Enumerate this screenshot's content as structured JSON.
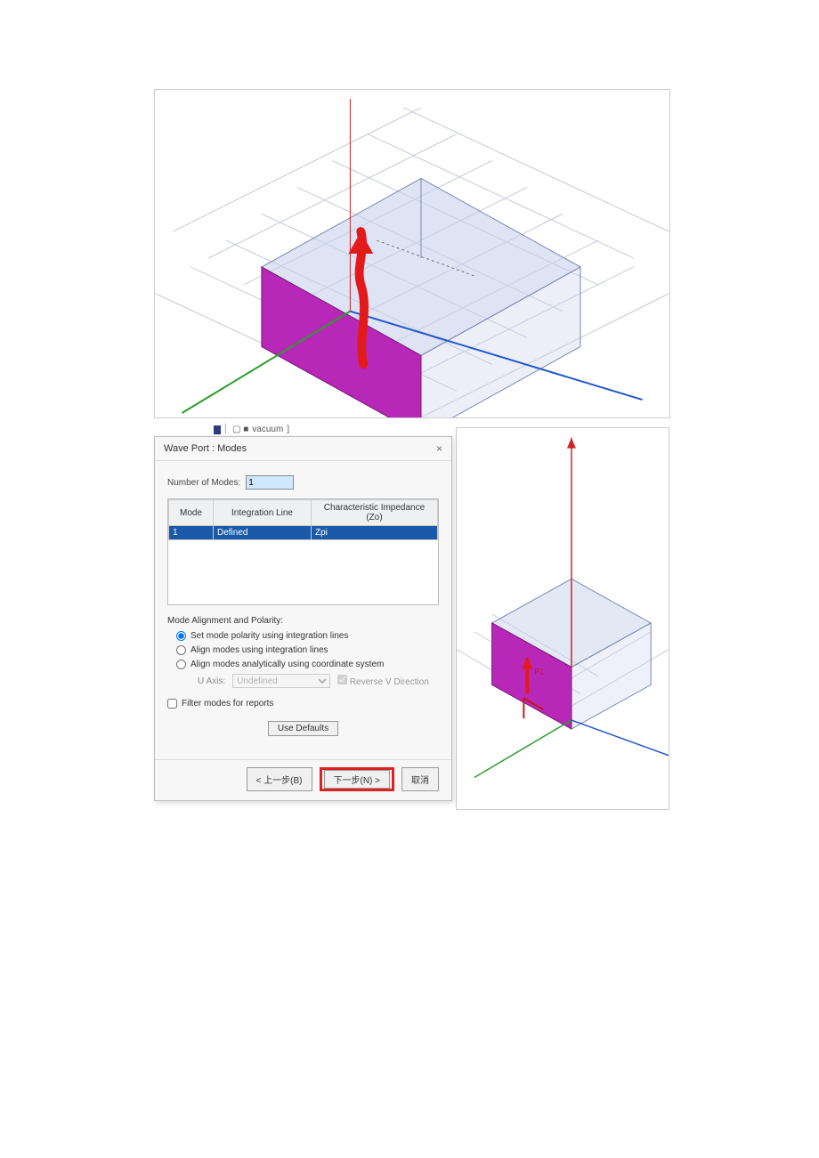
{
  "legend": {
    "material": "vacuum"
  },
  "dialog": {
    "title": "Wave Port : Modes",
    "num_modes_label": "Number of Modes:",
    "num_modes_value": "1",
    "table": {
      "headers": {
        "mode": "Mode",
        "intline": "Integration Line",
        "zo": "Characteristic Impedance (Zo)"
      },
      "row": {
        "mode": "1",
        "intline": "Defined",
        "zo": "Zpi"
      }
    },
    "align_label": "Mode Alignment and Polarity:",
    "opt_set_polarity": "Set mode polarity using integration lines",
    "opt_align_int": "Align modes using integration lines",
    "opt_align_coord": "Align modes analytically using coordinate system",
    "uaxis_label": "U Axis:",
    "uaxis_value": "Undefined",
    "reverse_v": "Reverse V Direction",
    "filter_label": "Filter modes for reports",
    "use_defaults": "Use Defaults",
    "back": "< 上一步(B)",
    "next": "下一步(N) >",
    "cancel": "取消"
  },
  "scene_right": {
    "port_label": "P1"
  }
}
